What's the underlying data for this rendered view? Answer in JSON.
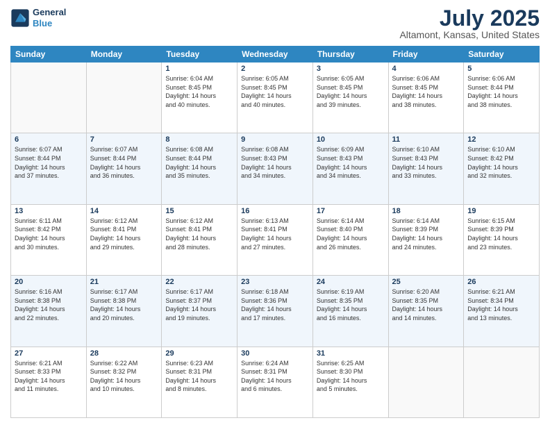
{
  "logo": {
    "line1": "General",
    "line2": "Blue"
  },
  "title": "July 2025",
  "subtitle": "Altamont, Kansas, United States",
  "headers": [
    "Sunday",
    "Monday",
    "Tuesday",
    "Wednesday",
    "Thursday",
    "Friday",
    "Saturday"
  ],
  "weeks": [
    [
      {
        "day": "",
        "info": ""
      },
      {
        "day": "",
        "info": ""
      },
      {
        "day": "1",
        "info": "Sunrise: 6:04 AM\nSunset: 8:45 PM\nDaylight: 14 hours\nand 40 minutes."
      },
      {
        "day": "2",
        "info": "Sunrise: 6:05 AM\nSunset: 8:45 PM\nDaylight: 14 hours\nand 40 minutes."
      },
      {
        "day": "3",
        "info": "Sunrise: 6:05 AM\nSunset: 8:45 PM\nDaylight: 14 hours\nand 39 minutes."
      },
      {
        "day": "4",
        "info": "Sunrise: 6:06 AM\nSunset: 8:45 PM\nDaylight: 14 hours\nand 38 minutes."
      },
      {
        "day": "5",
        "info": "Sunrise: 6:06 AM\nSunset: 8:44 PM\nDaylight: 14 hours\nand 38 minutes."
      }
    ],
    [
      {
        "day": "6",
        "info": "Sunrise: 6:07 AM\nSunset: 8:44 PM\nDaylight: 14 hours\nand 37 minutes."
      },
      {
        "day": "7",
        "info": "Sunrise: 6:07 AM\nSunset: 8:44 PM\nDaylight: 14 hours\nand 36 minutes."
      },
      {
        "day": "8",
        "info": "Sunrise: 6:08 AM\nSunset: 8:44 PM\nDaylight: 14 hours\nand 35 minutes."
      },
      {
        "day": "9",
        "info": "Sunrise: 6:08 AM\nSunset: 8:43 PM\nDaylight: 14 hours\nand 34 minutes."
      },
      {
        "day": "10",
        "info": "Sunrise: 6:09 AM\nSunset: 8:43 PM\nDaylight: 14 hours\nand 34 minutes."
      },
      {
        "day": "11",
        "info": "Sunrise: 6:10 AM\nSunset: 8:43 PM\nDaylight: 14 hours\nand 33 minutes."
      },
      {
        "day": "12",
        "info": "Sunrise: 6:10 AM\nSunset: 8:42 PM\nDaylight: 14 hours\nand 32 minutes."
      }
    ],
    [
      {
        "day": "13",
        "info": "Sunrise: 6:11 AM\nSunset: 8:42 PM\nDaylight: 14 hours\nand 30 minutes."
      },
      {
        "day": "14",
        "info": "Sunrise: 6:12 AM\nSunset: 8:41 PM\nDaylight: 14 hours\nand 29 minutes."
      },
      {
        "day": "15",
        "info": "Sunrise: 6:12 AM\nSunset: 8:41 PM\nDaylight: 14 hours\nand 28 minutes."
      },
      {
        "day": "16",
        "info": "Sunrise: 6:13 AM\nSunset: 8:41 PM\nDaylight: 14 hours\nand 27 minutes."
      },
      {
        "day": "17",
        "info": "Sunrise: 6:14 AM\nSunset: 8:40 PM\nDaylight: 14 hours\nand 26 minutes."
      },
      {
        "day": "18",
        "info": "Sunrise: 6:14 AM\nSunset: 8:39 PM\nDaylight: 14 hours\nand 24 minutes."
      },
      {
        "day": "19",
        "info": "Sunrise: 6:15 AM\nSunset: 8:39 PM\nDaylight: 14 hours\nand 23 minutes."
      }
    ],
    [
      {
        "day": "20",
        "info": "Sunrise: 6:16 AM\nSunset: 8:38 PM\nDaylight: 14 hours\nand 22 minutes."
      },
      {
        "day": "21",
        "info": "Sunrise: 6:17 AM\nSunset: 8:38 PM\nDaylight: 14 hours\nand 20 minutes."
      },
      {
        "day": "22",
        "info": "Sunrise: 6:17 AM\nSunset: 8:37 PM\nDaylight: 14 hours\nand 19 minutes."
      },
      {
        "day": "23",
        "info": "Sunrise: 6:18 AM\nSunset: 8:36 PM\nDaylight: 14 hours\nand 17 minutes."
      },
      {
        "day": "24",
        "info": "Sunrise: 6:19 AM\nSunset: 8:35 PM\nDaylight: 14 hours\nand 16 minutes."
      },
      {
        "day": "25",
        "info": "Sunrise: 6:20 AM\nSunset: 8:35 PM\nDaylight: 14 hours\nand 14 minutes."
      },
      {
        "day": "26",
        "info": "Sunrise: 6:21 AM\nSunset: 8:34 PM\nDaylight: 14 hours\nand 13 minutes."
      }
    ],
    [
      {
        "day": "27",
        "info": "Sunrise: 6:21 AM\nSunset: 8:33 PM\nDaylight: 14 hours\nand 11 minutes."
      },
      {
        "day": "28",
        "info": "Sunrise: 6:22 AM\nSunset: 8:32 PM\nDaylight: 14 hours\nand 10 minutes."
      },
      {
        "day": "29",
        "info": "Sunrise: 6:23 AM\nSunset: 8:31 PM\nDaylight: 14 hours\nand 8 minutes."
      },
      {
        "day": "30",
        "info": "Sunrise: 6:24 AM\nSunset: 8:31 PM\nDaylight: 14 hours\nand 6 minutes."
      },
      {
        "day": "31",
        "info": "Sunrise: 6:25 AM\nSunset: 8:30 PM\nDaylight: 14 hours\nand 5 minutes."
      },
      {
        "day": "",
        "info": ""
      },
      {
        "day": "",
        "info": ""
      }
    ]
  ]
}
